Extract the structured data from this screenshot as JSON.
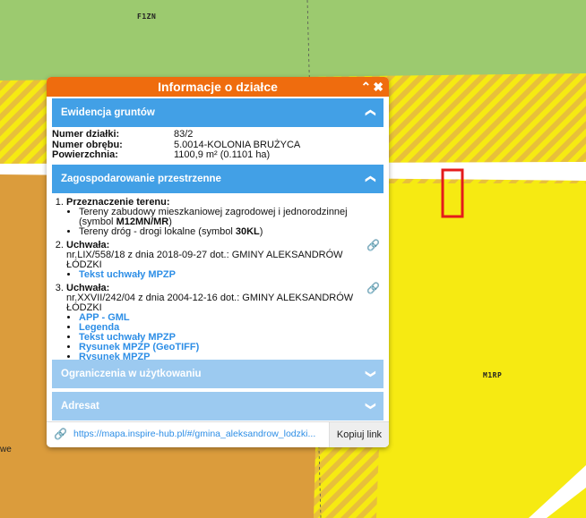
{
  "map": {
    "zone_labels": {
      "top": "F1ZN",
      "right": "M1RP"
    },
    "edge_text": "we",
    "colors": {
      "green": "#9cca6f",
      "orange": "#db9c3c",
      "yellow": "#f6ea12",
      "stripe": "#e8c03a",
      "road": "#ffffff",
      "highlight": "#e41b1b"
    }
  },
  "panel": {
    "title": "Informacje o działce",
    "controls": [
      "collapse-icon",
      "close-icon"
    ],
    "sections": {
      "grunty": {
        "title": "Ewidencja gruntów",
        "rows": [
          {
            "k": "Numer działki:",
            "v": "83/2"
          },
          {
            "k": "Numer obrębu:",
            "v": "5.0014-KOLONIA BRUŻYCA"
          },
          {
            "k": "Powierzchnia:",
            "v": "1100,9 m² (0.1101 ha)"
          }
        ]
      },
      "plan": {
        "title": "Zagospodarowanie przestrzenne",
        "p1_label": "Przeznaczenie terenu:",
        "p1_b1_text": "Tereny zabudowy mieszkaniowej zagrodowej i jednorodzinnej (symbol ",
        "p1_b1_sym": "M12MN/MR",
        "p1_b1_end": ")",
        "p1_b2_text": "Tereny dróg - drogi lokalne (symbol ",
        "p1_b2_sym": "30KL",
        "p1_b2_end": ")",
        "p2_label": "Uchwała:",
        "p2_text": "nr.LIX/558/18 z dnia 2018-09-27 dot.: GMINY ALEKSANDRÓW ŁÓDZKI",
        "p2_links": [
          "Tekst uchwały MPZP"
        ],
        "p3_label": "Uchwała:",
        "p3_text": "nr.XXVII/242/04 z dnia 2004-12-16 dot.: GMINY ALEKSANDRÓW ŁÓDZKI",
        "p3_links": [
          "APP - GML",
          "Legenda",
          "Tekst uchwały MPZP",
          "Rysunek MPZP (GeoTIFF)",
          "Rysunek MPZP"
        ]
      },
      "ograniczenia": {
        "title": "Ograniczenia w użytkowaniu"
      },
      "adresat": {
        "title": "Adresat"
      }
    },
    "footer": {
      "url": "https://mapa.inspire-hub.pl/#/gmina_aleksandrow_lodzki...",
      "copy_label": "Kopiuj link"
    }
  }
}
